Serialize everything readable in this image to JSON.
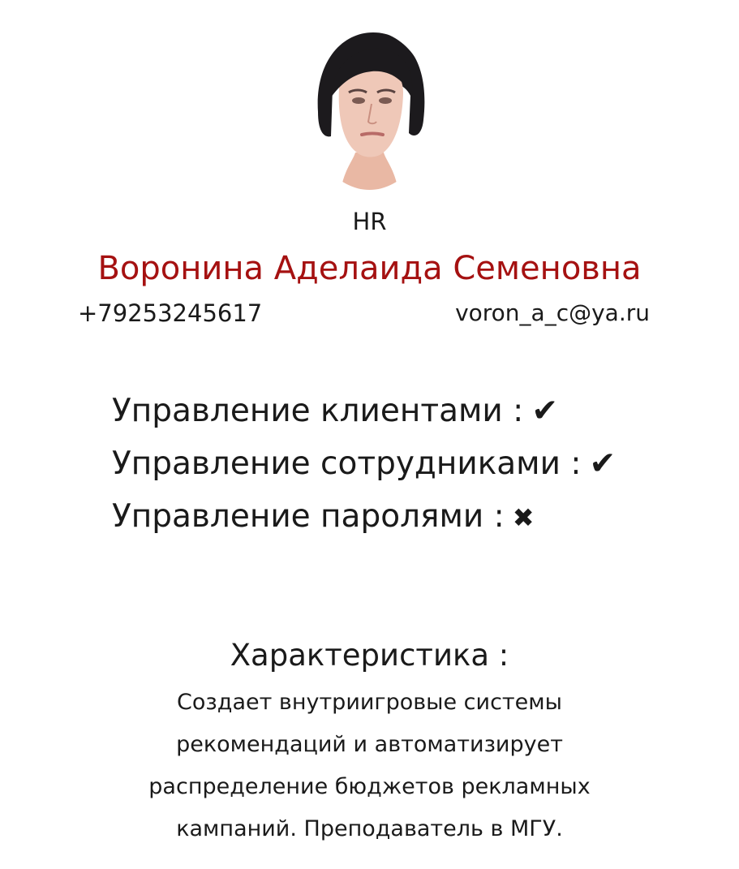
{
  "profile": {
    "avatar_icon": "user-photo",
    "role": "HR",
    "full_name": "Воронина Аделаида Семеновна",
    "phone": "+79253245617",
    "email": "voron_a_c@ya.ru"
  },
  "colors": {
    "name": "#a51111",
    "text": "#1a1a1a",
    "background": "#ffffff"
  },
  "permissions": [
    {
      "label": "Управление клиентами :",
      "mark": "✔",
      "granted": true
    },
    {
      "label": "Управление сотрудниками :",
      "mark": "✔",
      "granted": true
    },
    {
      "label": "Управление паролями :",
      "mark": "✖",
      "granted": false
    }
  ],
  "characteristic": {
    "title": "Характеристика :",
    "text": "Создает внутриигровые системы рекомендаций и автоматизирует распределение бюджетов рекламных кампаний. Преподаватель в МГУ."
  }
}
